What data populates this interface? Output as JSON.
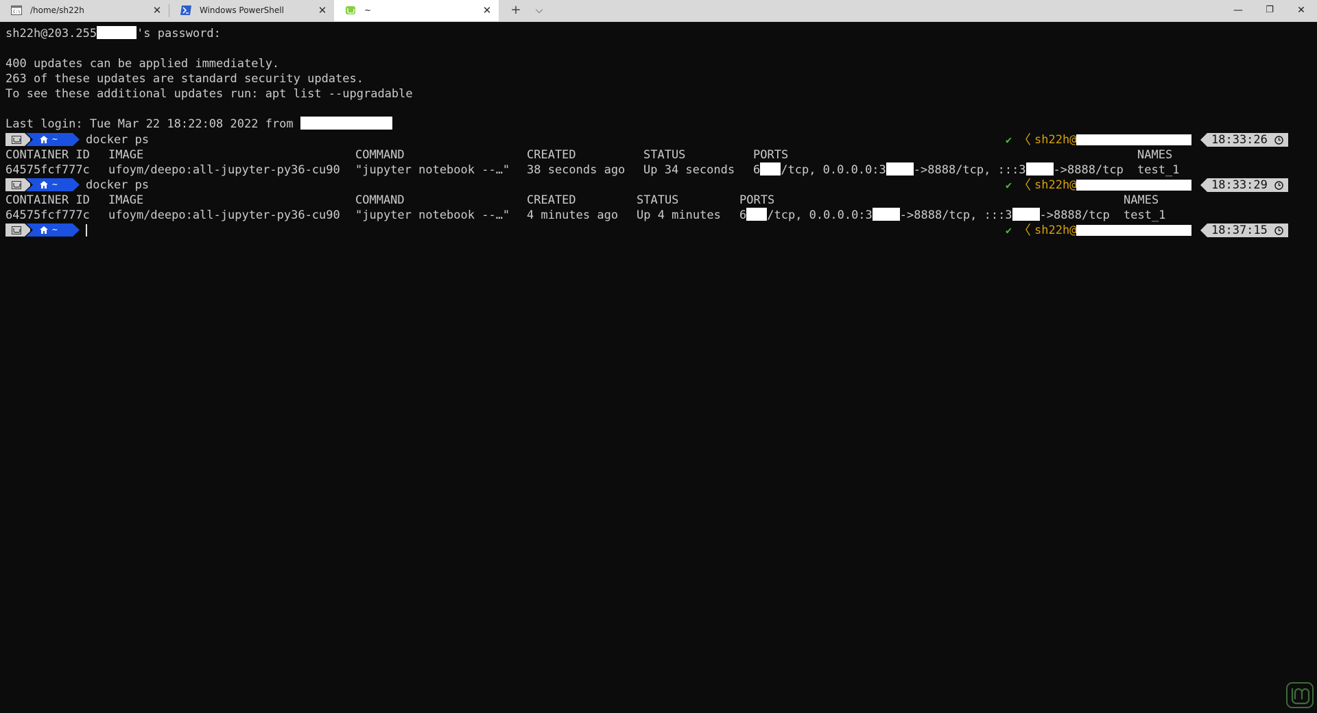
{
  "tabs": [
    {
      "title": "/home/sh22h",
      "icon": "cmd-icon"
    },
    {
      "title": "Windows PowerShell",
      "icon": "powershell-icon"
    },
    {
      "title": "~",
      "icon": "linux-mint-icon",
      "active": true
    }
  ],
  "terminal": {
    "password_prompt_start": "sh22h@203.255",
    "password_prompt_end": "'s password:",
    "updates_line1": "400 updates can be applied immediately.",
    "updates_line2": "263 of these updates are standard security updates.",
    "updates_line3": "To see these additional updates run: apt list --upgradable",
    "last_login": "Last login: Tue Mar 22 18:22:08 2022 from ",
    "command": "docker ps",
    "headers": {
      "container_id": "CONTAINER ID",
      "image": "IMAGE",
      "command": "COMMAND",
      "created": "CREATED",
      "status": "STATUS",
      "ports": "PORTS",
      "names": "NAMES"
    },
    "rows": [
      {
        "container_id": "64575fcf777c",
        "image": "ufoym/deepo:all-jupyter-py36-cu90",
        "command": "\"jupyter notebook --…\"",
        "created": "38 seconds ago",
        "status": "Up 34 seconds",
        "ports_a": "6",
        "ports_b": "/tcp, 0.0.0.0:3",
        "ports_c": "->8888/tcp, :::3",
        "ports_d": "->8888/tcp",
        "name": "test_1"
      },
      {
        "container_id": "64575fcf777c",
        "image": "ufoym/deepo:all-jupyter-py36-cu90",
        "command": "\"jupyter notebook --…\"",
        "created": "4 minutes ago",
        "status": "Up 4 minutes",
        "ports_a": "6",
        "ports_b": "/tcp, 0.0.0.0:3",
        "ports_c": "->8888/tcp, :::3",
        "ports_d": "->8888/tcp",
        "name": "test_1"
      }
    ],
    "prompt": {
      "home_icon": "home-icon",
      "home_dir": "~",
      "user": "sh22h@",
      "check": "✔",
      "times": [
        "18:33:26",
        "18:33:29",
        "18:37:15"
      ]
    }
  },
  "colors": {
    "background": "#0c0c0c",
    "text": "#cccccc",
    "prompt_blue": "#1a51e0",
    "prompt_gray": "#d0d0d0",
    "user_gold": "#d7a10c",
    "check_green": "#4fbf3d"
  }
}
